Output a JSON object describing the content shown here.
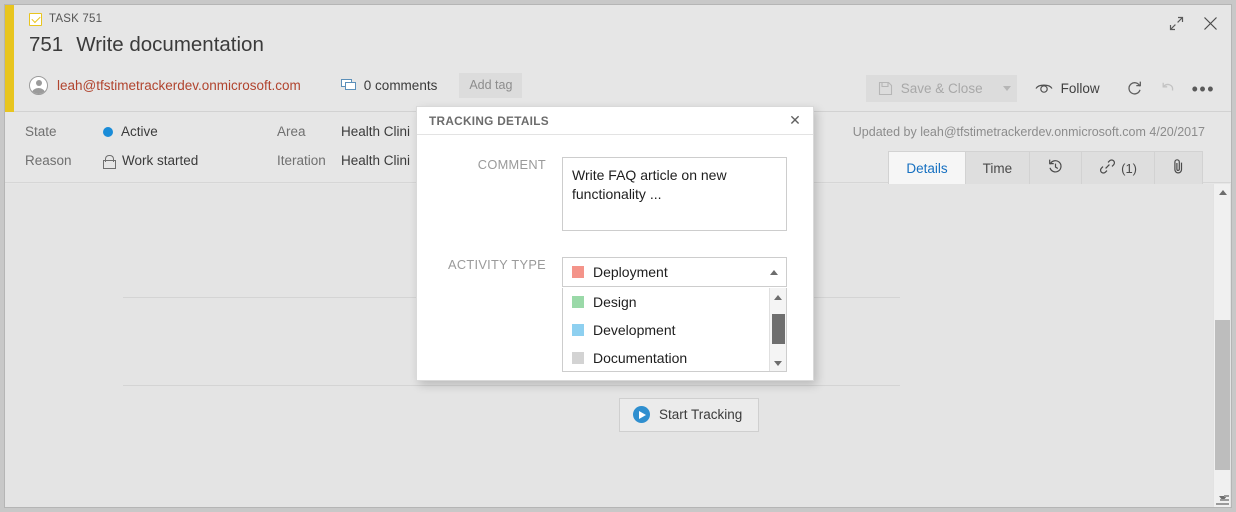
{
  "window": {
    "work_item_type": "TASK 751",
    "type_icon": "task-clipboard-icon",
    "expand_icon": "expand-diagonal-icon",
    "close_icon": "close-x-icon"
  },
  "header": {
    "id": "751",
    "title": "Write documentation",
    "assignee": "leah@tfstimetrackerdev.onmicrosoft.com",
    "comments_label": "0 comments",
    "add_tag_label": "Add tag",
    "save_close_label": "Save & Close",
    "follow_label": "Follow",
    "refresh_icon": "refresh-icon",
    "undo_icon": "undo-icon",
    "more_icon": "ellipsis-icon",
    "accent_color": "#e8c51f",
    "assignee_color": "#b1442e"
  },
  "fields": {
    "state_label": "State",
    "state_value": "Active",
    "state_color": "#1a8cd8",
    "reason_label": "Reason",
    "reason_value": "Work started",
    "area_label": "Area",
    "area_value": "Health Clini",
    "iteration_label": "Iteration",
    "iteration_value": "Health Clini",
    "updated_by": "Updated by leah@tfstimetrackerdev.onmicrosoft.com 4/20/2017"
  },
  "tabs": [
    {
      "label": "Details",
      "active": true
    },
    {
      "label": "Time",
      "active": false
    },
    {
      "label": "",
      "icon": "history-clock-icon",
      "active": false
    },
    {
      "label": "",
      "icon": "link-icon",
      "count": "(1)",
      "active": false
    },
    {
      "label": "",
      "icon": "paperclip-icon",
      "active": false
    }
  ],
  "content": {
    "start_tracking_label": "Start Tracking",
    "play_icon": "play-circle-icon",
    "play_color": "#2f8fcf"
  },
  "dialog": {
    "title": "TRACKING DETAILS",
    "close_icon": "close-x-icon",
    "comment_label": "COMMENT",
    "comment_value": "Write FAQ article on new functionality ...",
    "activity_label": "ACTIVITY TYPE",
    "activity_selected": "Deployment",
    "activity_selected_color": "#f4948a",
    "options": [
      {
        "label": "Design",
        "color": "#9ad9a8"
      },
      {
        "label": "Development",
        "color": "#8ed0f0"
      },
      {
        "label": "Documentation",
        "color": "#d3d3d3"
      }
    ]
  },
  "scrollbars": {
    "content_up_icon": "scroll-up-arrow-icon",
    "content_down_icon": "scroll-down-arrow-icon",
    "list_up_icon": "scroll-up-arrow-icon",
    "list_down_icon": "scroll-down-arrow-icon",
    "resize_grip_icon": "resize-grip-icon"
  }
}
